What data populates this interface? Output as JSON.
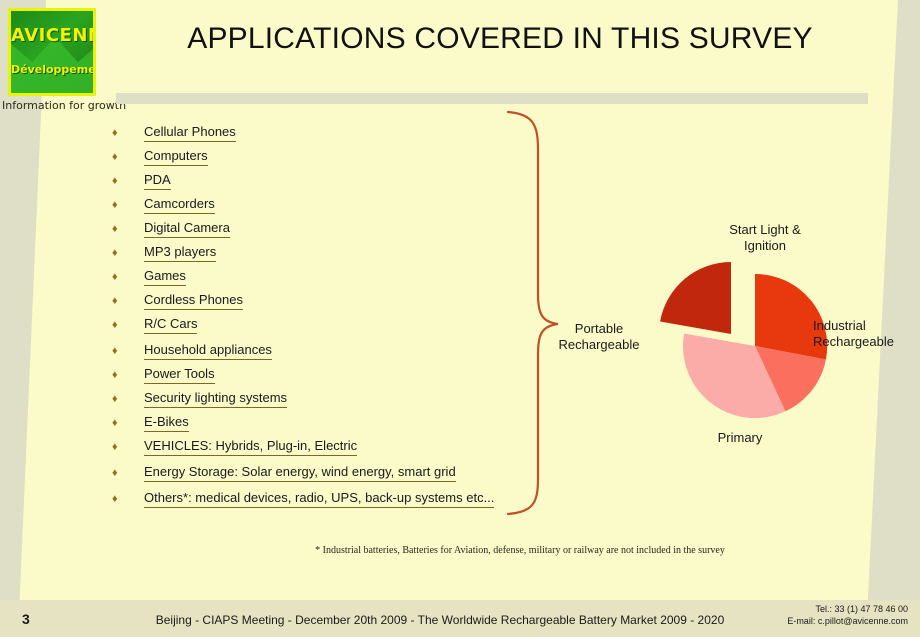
{
  "brand": {
    "logo_name": "AVICENNE",
    "logo_sub": "Développement",
    "tagline": "Information for growth",
    "logo_bg": "#2AA520",
    "logo_border": "#EAF20A",
    "logo_text_color": "#F2F209"
  },
  "header": {
    "title": "APPLICATIONS COVERED IN THIS SURVEY"
  },
  "theme": {
    "slide_bg": "#FBFAC9",
    "band_color": "#DEDFC6",
    "rule_color": "#DEDFC6",
    "bullet_color": "#8C7415",
    "underline_color": "#7A6A20",
    "brace_color": "#C0502A",
    "footer_bg": "#E6E3C2"
  },
  "bullets": {
    "marker": "♦",
    "items": [
      "Cellular Phones",
      "Computers",
      "PDA",
      "Camcorders",
      "Digital Camera",
      "MP3 players",
      "Games",
      "Cordless Phones",
      "R/C Cars",
      "Household appliances",
      "Power Tools",
      "Security lighting systems",
      "E-Bikes",
      "VEHICLES: Hybrids, Plug-in, Electric",
      "Energy Storage: Solar energy, wind energy, smart grid",
      "Others*: medical devices, radio, UPS, back-up systems etc..."
    ]
  },
  "brace": {
    "group_label_line1": "Portable",
    "group_label_line2": "Rechargeable"
  },
  "chart_data": {
    "type": "pie",
    "title": "",
    "legend_position": "outside-labels",
    "categories": [
      "Start Light & Ignition",
      "Industrial Rechargeable",
      "Primary",
      "Portable Rechargeable"
    ],
    "values": [
      28,
      15,
      29,
      28
    ],
    "colors": [
      "#E8380D",
      "#FA6F5E",
      "#FCACA8",
      "#C0270C"
    ],
    "exploded": [
      "Portable Rechargeable"
    ],
    "labels": {
      "start_light": "Start Light &\nIgnition",
      "start_light_line1": "Start Light &",
      "start_light_line2": "Ignition",
      "industrial_line1": "Industrial",
      "industrial_line2": "Rechargeable",
      "primary": "Primary",
      "portable_line1": "Portable",
      "portable_line2": "Rechargeable"
    }
  },
  "footnote": {
    "text": "* Industrial batteries, Batteries for Aviation, defense, military or railway are not included in the survey"
  },
  "footer": {
    "page_number": "3",
    "center_text": "Beijing - CIAPS Meeting - December 20th 2009 - The Worldwide Rechargeable  Battery Market 2009 - 2020",
    "tel": "Tel.: 33 (1) 47 78 46 00",
    "email": "E-mail: c.pillot@avicenne.com"
  }
}
